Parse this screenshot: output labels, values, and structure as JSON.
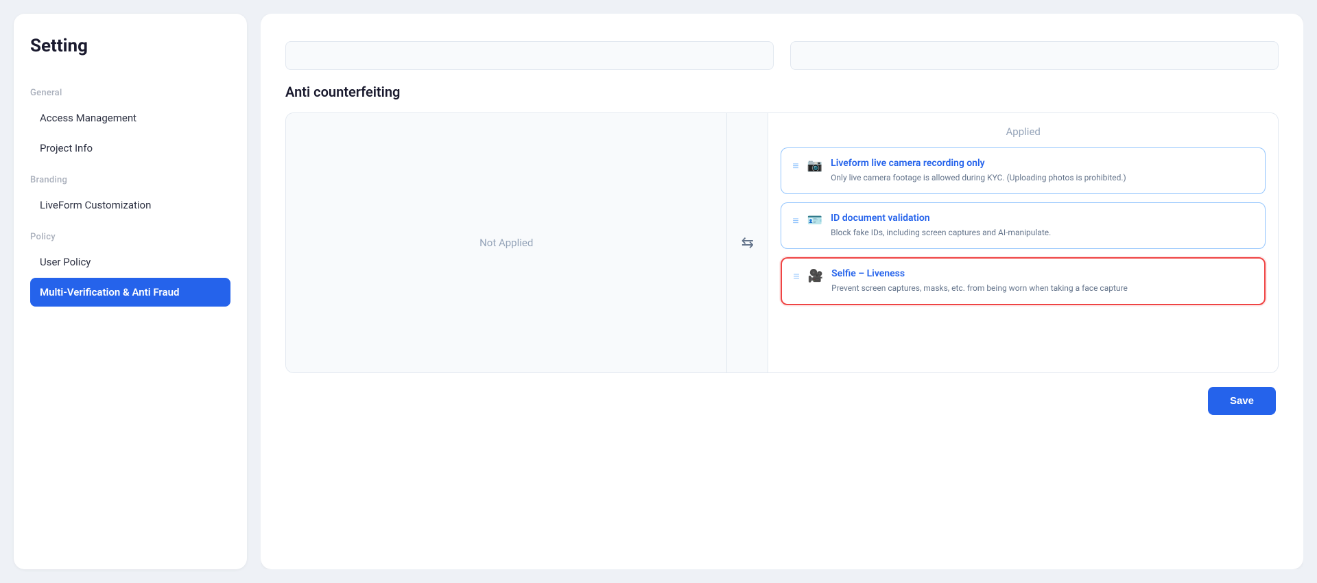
{
  "sidebar": {
    "title": "Setting",
    "sections": [
      {
        "label": "General",
        "items": [
          {
            "id": "access-management",
            "label": "Access Management",
            "active": false
          },
          {
            "id": "project-info",
            "label": "Project Info",
            "active": false
          }
        ]
      },
      {
        "label": "Branding",
        "items": [
          {
            "id": "liveform-customization",
            "label": "LiveForm Customization",
            "active": false
          }
        ]
      },
      {
        "label": "Policy",
        "items": [
          {
            "id": "user-policy",
            "label": "User Policy",
            "active": false
          },
          {
            "id": "multi-verification",
            "label": "Multi-Verification & Anti Fraud",
            "active": true
          }
        ]
      }
    ]
  },
  "main": {
    "section_title": "Anti counterfeiting",
    "not_applied_label": "Not Applied",
    "applied_label": "Applied",
    "transfer_icon": "⇆",
    "cards": [
      {
        "id": "liveform-camera",
        "title": "Liveform live camera recording only",
        "description": "Only live camera footage is allowed during KYC. (Uploading photos is prohibited.)",
        "selected": false,
        "drag_icon": "≡",
        "type_icon": "📷"
      },
      {
        "id": "id-document-validation",
        "title": "ID document validation",
        "description": "Block fake IDs, including screen captures and AI-manipulate.",
        "selected": false,
        "drag_icon": "≡",
        "type_icon": "🪪"
      },
      {
        "id": "selfie-liveness",
        "title": "Selfie – Liveness",
        "description": "Prevent screen captures, masks, etc. from being worn when taking a face capture",
        "selected": true,
        "drag_icon": "≡",
        "type_icon": "🎥"
      }
    ],
    "save_button_label": "Save"
  }
}
